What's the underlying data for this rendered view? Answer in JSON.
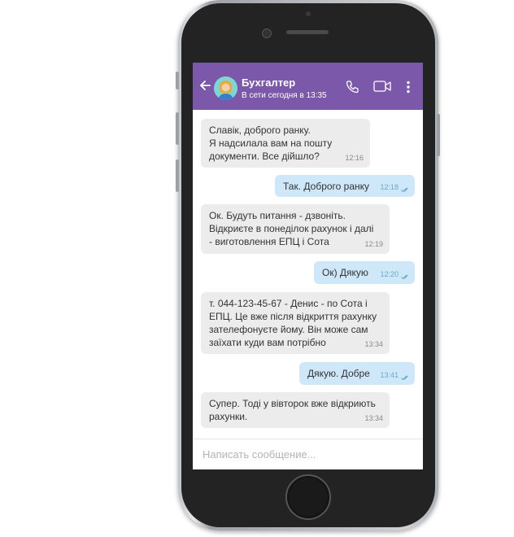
{
  "chat": {
    "contact_name": "Бухгалтер",
    "status": "В сети сегодня в 13:35"
  },
  "messages": [
    {
      "dir": "in",
      "lines": [
        "Славік, доброго ранку.",
        "Я надсилала вам на пошту",
        "документи. Все дійшло?"
      ],
      "time": "12:16"
    },
    {
      "dir": "out",
      "lines": [
        "Так. Доброго ранку"
      ],
      "time": "12:18"
    },
    {
      "dir": "in",
      "lines": [
        "Ок. Будуть питання - дзвоніть.",
        "Відкриєте в понеділок рахунок і далі",
        "- виготовлення ЕПЦ і Сота"
      ],
      "time": "12:19"
    },
    {
      "dir": "out",
      "lines": [
        "Ок) Дякую"
      ],
      "time": "12:20"
    },
    {
      "dir": "in",
      "lines": [
        "т. 044-123-45-67 - Денис - по Сота і",
        "ЕПЦ. Це вже після відкриття рахунку",
        "зателефонуєте йому. Він може сам",
        "заїхати куди вам потрібно"
      ],
      "time": "13:34"
    },
    {
      "dir": "out",
      "lines": [
        "Дякую. Добре"
      ],
      "time": "13:41"
    },
    {
      "dir": "in",
      "lines": [
        "Супер. Тоді у вівторок вже відкриють",
        "рахунки."
      ],
      "time": "13:34"
    }
  ],
  "composer": {
    "placeholder": "Написать сообщение..."
  },
  "colors": {
    "header": "#7b58a9",
    "incoming_bubble": "#ececec",
    "outgoing_bubble": "#cfe8f9"
  }
}
